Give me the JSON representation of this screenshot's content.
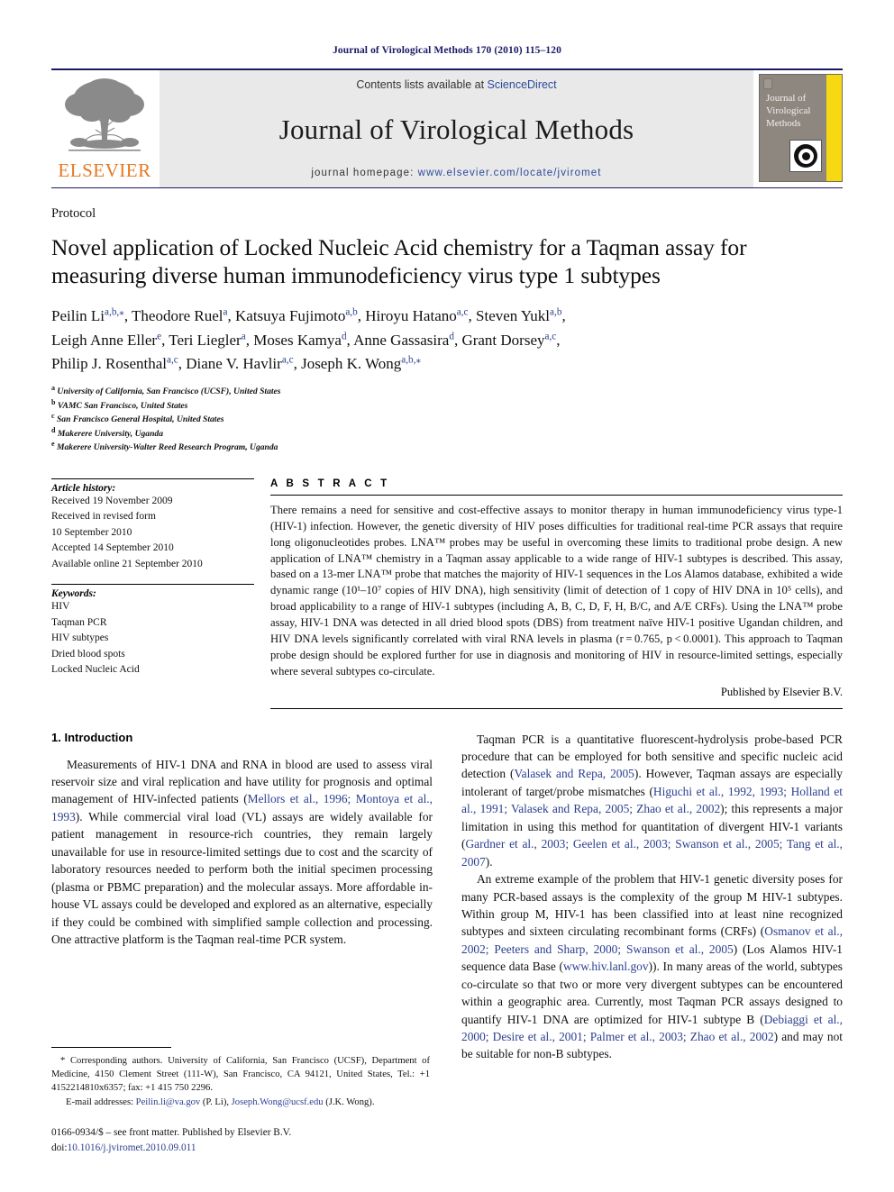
{
  "running_head": "Journal of Virological Methods 170 (2010) 115–120",
  "masthead": {
    "publisher_name": "ELSEVIER",
    "contents_prefix": "Contents lists available at ",
    "contents_link": "ScienceDirect",
    "journal_title": "Journal of Virological Methods",
    "homepage_prefix": "journal homepage: ",
    "homepage_url": "www.elsevier.com/locate/jviromet",
    "cover_title_line1": "Journal of",
    "cover_title_line2": "Virological",
    "cover_title_line3": "Methods",
    "accent_yellow": "#f7d913",
    "accent_orange": "#E87722",
    "link_blue": "#2b4a9b"
  },
  "article": {
    "type": "Protocol",
    "title": "Novel application of Locked Nucleic Acid chemistry for a Taqman assay for measuring diverse human immunodeficiency virus type 1 subtypes",
    "authors_line1": "Peilin Li<sup>a,b,⁎</sup>, Theodore Ruel<sup>a</sup>, Katsuya Fujimoto<sup>a,b</sup>, Hiroyu Hatano<sup>a,c</sup>, Steven Yukl<sup>a,b</sup>,",
    "authors_line2": "Leigh Anne Eller<sup>e</sup>, Teri Liegler<sup>a</sup>, Moses Kamya<sup>d</sup>, Anne Gassasira<sup>d</sup>, Grant Dorsey<sup>a,c</sup>,",
    "authors_line3": "Philip J. Rosenthal<sup>a,c</sup>, Diane V. Havlir<sup>a,c</sup>, Joseph K. Wong<sup>a,b,⁎</sup>",
    "affiliations": [
      {
        "marker": "a",
        "text": "University of California, San Francisco (UCSF), United States"
      },
      {
        "marker": "b",
        "text": "VAMC San Francisco, United States"
      },
      {
        "marker": "c",
        "text": "San Francisco General Hospital, United States"
      },
      {
        "marker": "d",
        "text": "Makerere University, Uganda"
      },
      {
        "marker": "e",
        "text": "Makerere University-Walter Reed Research Program, Uganda"
      }
    ]
  },
  "article_history": {
    "label": "Article history:",
    "lines": [
      "Received 19 November 2009",
      "Received in revised form",
      "10 September 2010",
      "Accepted 14 September 2010",
      "Available online 21 September 2010"
    ]
  },
  "keywords": {
    "label": "Keywords:",
    "items": [
      "HIV",
      "Taqman PCR",
      "HIV subtypes",
      "Dried blood spots",
      "Locked Nucleic Acid"
    ]
  },
  "abstract": {
    "heading": "A B S T R A C T",
    "text": "There remains a need for sensitive and cost-effective assays to monitor therapy in human immunodeficiency virus type-1 (HIV-1) infection. However, the genetic diversity of HIV poses difficulties for traditional real-time PCR assays that require long oligonucleotides probes. LNA™ probes may be useful in overcoming these limits to traditional probe design. A new application of LNA™ chemistry in a Taqman assay applicable to a wide range of HIV-1 subtypes is described. This assay, based on a 13-mer LNA™ probe that matches the majority of HIV-1 sequences in the Los Alamos database, exhibited a wide dynamic range (10¹–10⁷ copies of HIV DNA), high sensitivity (limit of detection of 1 copy of HIV DNA in 10⁵ cells), and broad applicability to a range of HIV-1 subtypes (including A, B, C, D, F, H, B/C, and A/E CRFs). Using the LNA™ probe assay, HIV-1 DNA was detected in all dried blood spots (DBS) from treatment naïve HIV-1 positive Ugandan children, and HIV DNA levels significantly correlated with viral RNA levels in plasma (r = 0.765, p < 0.0001). This approach to Taqman probe design should be explored further for use in diagnosis and monitoring of HIV in resource-limited settings, especially where several subtypes co-circulate.",
    "published_by": "Published by Elsevier B.V."
  },
  "introduction": {
    "heading": "1.  Introduction",
    "left_para_1": "Measurements of HIV-1 DNA and RNA in blood are used to assess viral reservoir size and viral replication and have utility for prognosis and optimal management of HIV-infected patients (<span class=\"ref\">Mellors et al., 1996; Montoya et al., 1993</span>). While commercial viral load (VL) assays are widely available for patient management in resource-rich countries, they remain largely unavailable for use in resource-limited settings due to cost and the scarcity of laboratory resources needed to perform both the initial specimen processing (plasma or PBMC preparation) and the molecular assays. More affordable in-house VL assays could be developed and explored as an alternative, especially if they could be combined with simplified sample collection and processing. One attractive platform is the Taqman real-time PCR system.",
    "right_para_1": "Taqman PCR is a quantitative fluorescent-hydrolysis probe-based PCR procedure that can be employed for both sensitive and specific nucleic acid detection (<span class=\"ref\">Valasek and Repa, 2005</span>). However, Taqman assays are especially intolerant of target/probe mismatches (<span class=\"ref\">Higuchi et al., 1992, 1993; Holland et al., 1991; Valasek and Repa, 2005; Zhao et al., 2002</span>); this represents a major limitation in using this method for quantitation of divergent HIV-1 variants (<span class=\"ref\">Gardner et al., 2003; Geelen et al., 2003; Swanson et al., 2005; Tang et al., 2007</span>).",
    "right_para_2": "An extreme example of the problem that HIV-1 genetic diversity poses for many PCR-based assays is the complexity of the group M HIV-1 subtypes. Within group M, HIV-1 has been classified into at least nine recognized subtypes and sixteen circulating recombinant forms (CRFs) (<span class=\"ref\">Osmanov et al., 2002; Peeters and Sharp, 2000; Swanson et al., 2005</span>) (Los Alamos HIV-1 sequence data Base (<span class=\"ref\">www.hiv.lanl.gov</span>)). In many areas of the world, subtypes co-circulate so that two or more very divergent subtypes can be encountered within a geographic area. Currently, most Taqman PCR assays designed to quantify HIV-1 DNA are optimized for HIV-1 subtype B (<span class=\"ref\">Debiaggi et al., 2000; Desire et al., 2001; Palmer et al., 2003; Zhao et al., 2002</span>) and may not be suitable for non-B subtypes."
  },
  "footnotes": {
    "corresponding": "* Corresponding authors. University of California, San Francisco (UCSF), Department of Medicine, 4150 Clement Street (111-W), San Francisco, CA 94121, United States, Tel.: +1 4152214810x6357; fax: +1 415 750 2296.",
    "emails": "E-mail addresses: <span class=\"ref\">Peilin.li@va.gov</span> (P. Li), <span class=\"ref\">Joseph.Wong@ucsf.edu</span> (J.K. Wong).",
    "imprint_line": "0166-0934/$ – see front matter. Published by Elsevier B.V.",
    "doi_prefix": "doi:",
    "doi": "10.1016/j.jviromet.2010.09.011"
  }
}
